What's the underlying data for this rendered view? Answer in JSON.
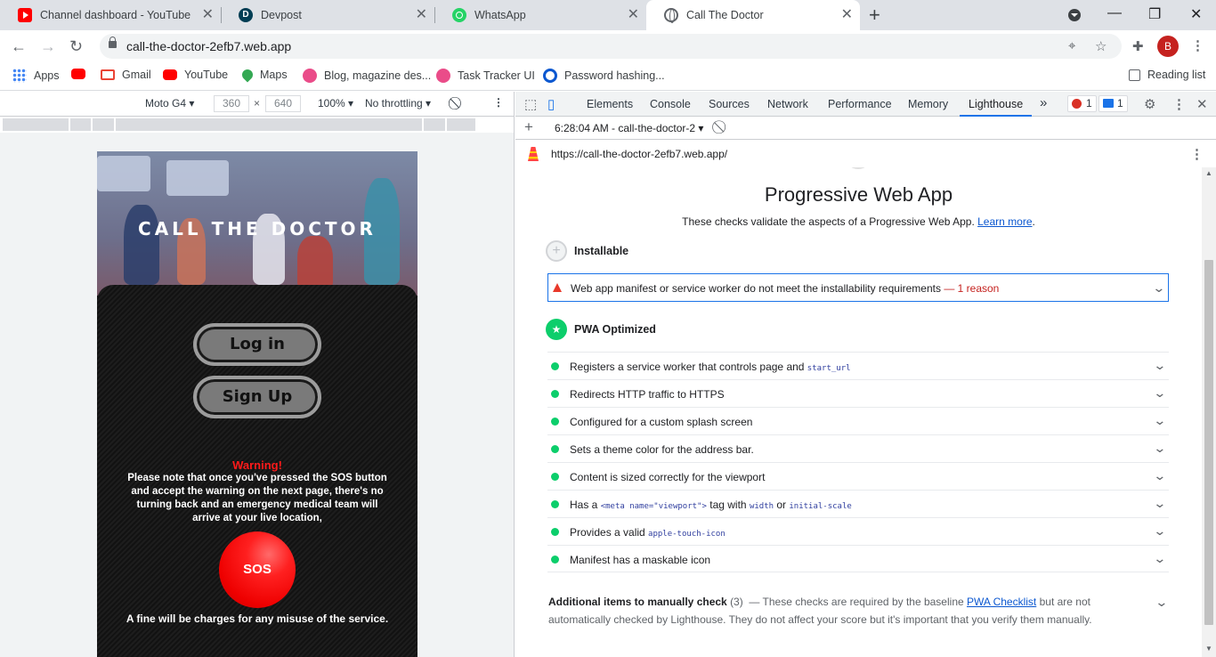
{
  "tabs": [
    {
      "title": "Channel dashboard - YouTube Studio",
      "icon": "youtube-icon"
    },
    {
      "title": "Devpost",
      "icon": "devpost-icon"
    },
    {
      "title": "WhatsApp",
      "icon": "whatsapp-icon"
    },
    {
      "title": "Call The Doctor",
      "icon": "globe-icon",
      "active": true
    }
  ],
  "address": {
    "url": "call-the-doctor-2efb7.web.app",
    "profile_initial": "B"
  },
  "bookmarks": {
    "items": [
      {
        "label": "Apps"
      },
      {
        "label": ""
      },
      {
        "label": "Gmail"
      },
      {
        "label": "YouTube"
      },
      {
        "label": "Maps"
      },
      {
        "label": "Blog, magazine des..."
      },
      {
        "label": "Task Tracker UI"
      },
      {
        "label": "Password hashing..."
      }
    ],
    "reading_list": "Reading list"
  },
  "device_toolbar": {
    "device": "Moto G4",
    "width": "360",
    "times": "×",
    "height": "640",
    "zoom": "100%",
    "throttling": "No throttling"
  },
  "site": {
    "hero_title": "CALL THE DOCTOR",
    "login_label": "Log in",
    "signup_label": "Sign Up",
    "warning_title": "Warning!",
    "warning_text": "Please note that once you've pressed the SOS button and accept the warning on the next page, there's no turning back and an emergency medical team will arrive at your live location,",
    "sos_label": "SOS",
    "fine_text": "A fine will be charges for any misuse of the service."
  },
  "devtools": {
    "tabs": [
      "Elements",
      "Console",
      "Sources",
      "Network",
      "Performance",
      "Memory",
      "Lighthouse"
    ],
    "active_tab": "Lighthouse",
    "more": "»",
    "error_count": "1",
    "message_count": "1",
    "report_time": "6:28:04 AM - call-the-doctor-2",
    "report_url": "https://call-the-doctor-2efb7.web.app/"
  },
  "report": {
    "title": "Progressive Web App",
    "description": "These checks validate the aspects of a Progressive Web App.",
    "learn_more": "Learn more",
    "installable_label": "Installable",
    "install_failure": "Web app manifest or service worker do not meet the installability requirements",
    "install_reason": "1 reason",
    "pwa_optimized_label": "PWA Optimized",
    "audits": [
      {
        "pre": "Registers a service worker that controls page and ",
        "code": "start_url"
      },
      {
        "pre": "Redirects HTTP traffic to HTTPS"
      },
      {
        "pre": "Configured for a custom splash screen"
      },
      {
        "pre": "Sets a theme color for the address bar."
      },
      {
        "pre": "Content is sized correctly for the viewport"
      },
      {
        "pre": "Has a ",
        "code": "<meta name=\"viewport\">",
        "mid": " tag with ",
        "code2": "width",
        "mid2": " or ",
        "code3": "initial-scale"
      },
      {
        "pre": "Provides a valid ",
        "code": "apple-touch-icon"
      },
      {
        "pre": "Manifest has a maskable icon"
      }
    ],
    "additional_title": "Additional items to manually check",
    "additional_count": "(3)",
    "additional_text_1": "These checks are required by the baseline",
    "pwa_checklist": "PWA Checklist",
    "additional_text_2": "but are not automatically checked by Lighthouse. They do not affect your score but it's important that you verify them manually."
  },
  "colors": {
    "accent": "#1a73e8",
    "pass": "#0cce6b",
    "fail": "#e8382a",
    "sos": "#ee0000"
  }
}
